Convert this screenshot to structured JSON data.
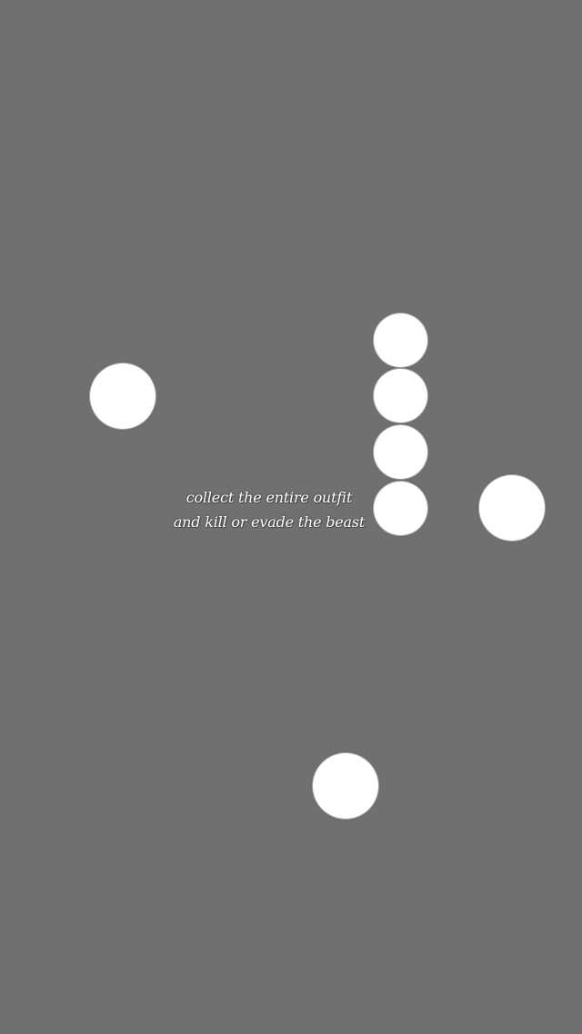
{
  "game": {
    "background_color": "#707070",
    "orb_color": "#ffffff",
    "instructions": {
      "line1": "collect the entire outfit",
      "line2": "and kill or evade the beast"
    },
    "outfit_slots_count": 4
  }
}
